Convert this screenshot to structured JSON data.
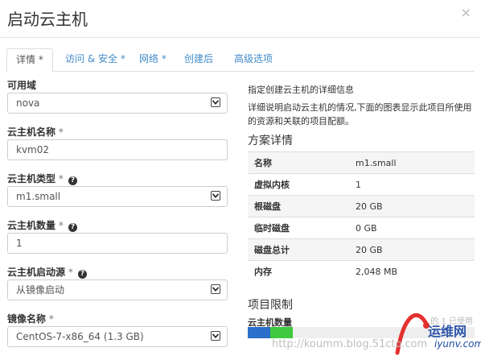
{
  "modal": {
    "title": "启动云主机",
    "close_icon": "×"
  },
  "tabs": [
    {
      "label": "详情",
      "star": " *"
    },
    {
      "label": "访问 & 安全",
      "star": " *"
    },
    {
      "label": "网络",
      "star": " *"
    },
    {
      "label": "创建后",
      "star": ""
    },
    {
      "label": "高级选项",
      "star": ""
    }
  ],
  "form": {
    "availability_zone": {
      "label": "可用域",
      "value": "nova"
    },
    "instance_name": {
      "label": "云主机名称",
      "star": " *",
      "value": "kvm02"
    },
    "flavor": {
      "label": "云主机类型",
      "star": " *",
      "value": "m1.small"
    },
    "count": {
      "label": "云主机数量",
      "star": " *",
      "value": "1"
    },
    "boot_source": {
      "label": "云主机启动源",
      "star": " *",
      "value": "从镜像启动"
    },
    "image": {
      "label": "镜像名称",
      "star": " *",
      "value": "CentOS-7-x86_64 (1.3 GB)"
    }
  },
  "help": {
    "line1": "指定创建云主机的详细信息",
    "line2": "详细说明启动云主机的情况,下面的图表显示此项目所使用的资源和关联的项目配额。"
  },
  "flavor_details": {
    "title": "方案详情",
    "rows": [
      {
        "key": "名称",
        "value": "m1.small"
      },
      {
        "key": "虚拟内核",
        "value": "1"
      },
      {
        "key": "根磁盘",
        "value": "20 GB"
      },
      {
        "key": "临时磁盘",
        "value": "0 GB"
      },
      {
        "key": "磁盘总计",
        "value": "20 GB"
      },
      {
        "key": "内存",
        "value": "2,048 MB"
      }
    ]
  },
  "project_limits": {
    "title": "项目限制",
    "instance_count_label": "云主机数量",
    "usage_text": "的 1 已使用",
    "used_fraction": 0.1,
    "added_fraction": 0.1
  },
  "watermark": {
    "url": "http://koumm.blog.51cto.com",
    "site_name": "运维网",
    "site_domain": "iyunv.com"
  },
  "colors": {
    "accent": "#428bca",
    "quota_used": "#2a6fc9",
    "quota_added": "#3ec93e"
  }
}
